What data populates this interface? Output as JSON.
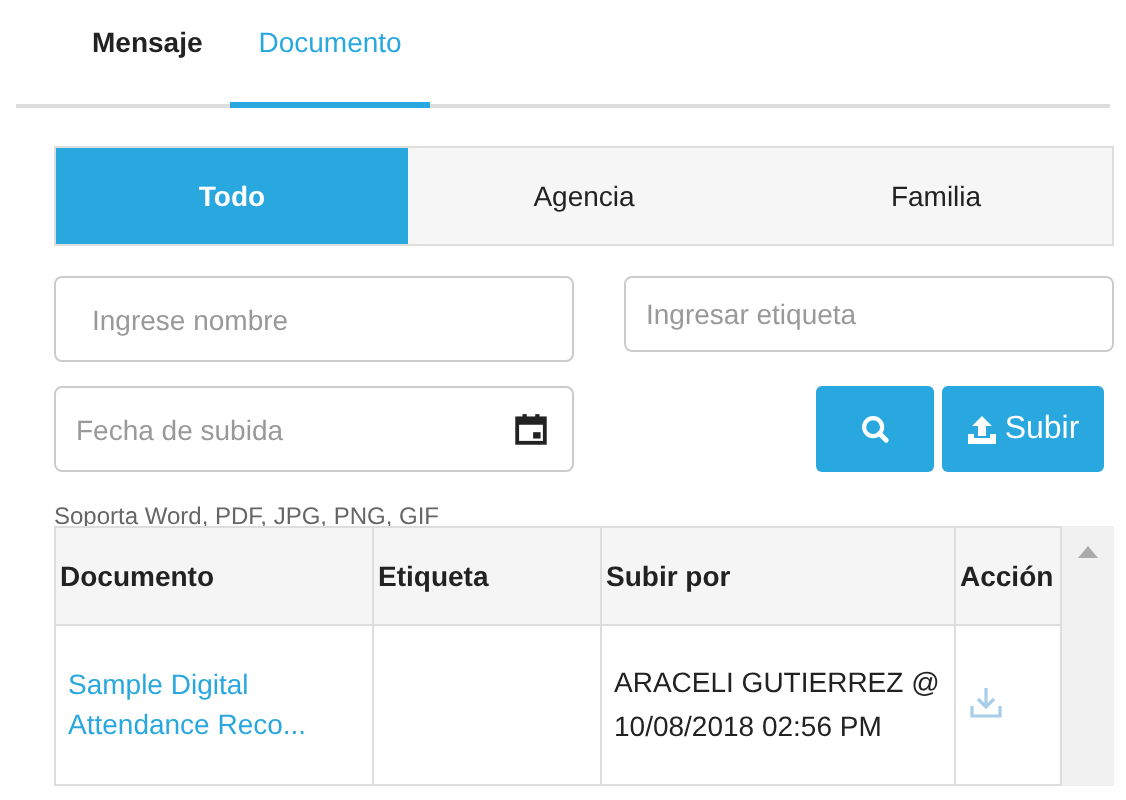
{
  "tabs": [
    {
      "label": "Mensaje",
      "selected": false
    },
    {
      "label": "Documento",
      "selected": true
    }
  ],
  "filters": [
    {
      "label": "Todo",
      "selected": true
    },
    {
      "label": "Agencia",
      "selected": false
    },
    {
      "label": "Familia",
      "selected": false
    }
  ],
  "name_field": {
    "placeholder": "Ingrese nombre"
  },
  "tag_field": {
    "placeholder": "Ingresar etiqueta"
  },
  "date_field": {
    "placeholder": "Fecha de subida"
  },
  "upload_button": {
    "label": "Subir"
  },
  "hint": "Soporta Word, PDF, JPG, PNG, GIF",
  "table": {
    "columns": [
      "Documento",
      "Etiqueta",
      "Subir por",
      "Acción"
    ],
    "rows": [
      {
        "document": "Sample Digital Attendance Reco...",
        "tag": "",
        "uploaded_by": "ARACELI GUTIERREZ @ 10/08/2018 02:56 PM"
      }
    ]
  }
}
